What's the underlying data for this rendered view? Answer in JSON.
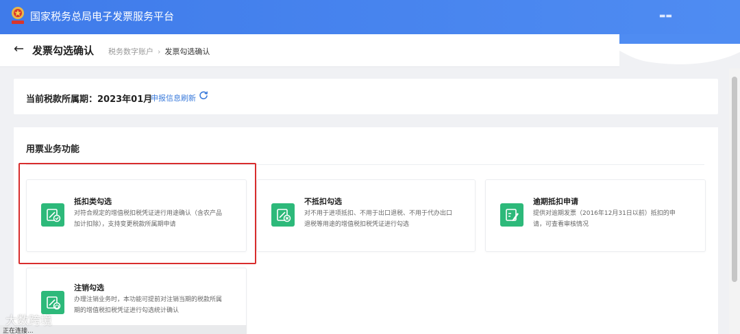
{
  "header": {
    "app_title": "国家税务总局电子发票服务平台",
    "user_menu": "▬▬",
    "brand_color": "#4f8cf2"
  },
  "subheader": {
    "page_title": "发票勾选确认",
    "breadcrumb": [
      "税务数字账户",
      "发票勾选确认"
    ]
  },
  "period": {
    "label": "当前税款所属期：2023年01月",
    "refresh_link": "申报信息刷新",
    "refresh_icon": "refresh-icon"
  },
  "functions": {
    "title": "用票业务功能",
    "items": [
      {
        "title": "抵扣类勾选",
        "desc": [
          "对符合规定的增值税扣税凭证进行用途确认（含农产品",
          "加计扣除），支持变更税款所属期申请"
        ],
        "icon": "deduct-check-icon",
        "highlighted": true
      },
      {
        "title": "不抵扣勾选",
        "desc": [
          "对不用于进项抵扣、不用于出口退税、不用于代办出口",
          "退税等用途的增值税扣税凭证进行勾选"
        ],
        "icon": "no-deduct-icon"
      },
      {
        "title": "逾期抵扣申请",
        "desc": [
          "提供对逾期发票（2016年12月31日以前）抵扣的申",
          "请，可查看审核情况"
        ],
        "icon": "overdue-apply-icon"
      },
      {
        "title": "注销勾选",
        "desc": [
          "办理注销业务时，本功能可提前对注销当期的税款所属",
          "期的增值税扣税凭证进行勾选统计确认"
        ],
        "icon": "cancel-check-icon"
      }
    ],
    "accent_color": "#2db97a",
    "highlight_color": "#d82c2c"
  },
  "status": {
    "text": "正在连接...",
    "watermark": "大数跨境"
  }
}
